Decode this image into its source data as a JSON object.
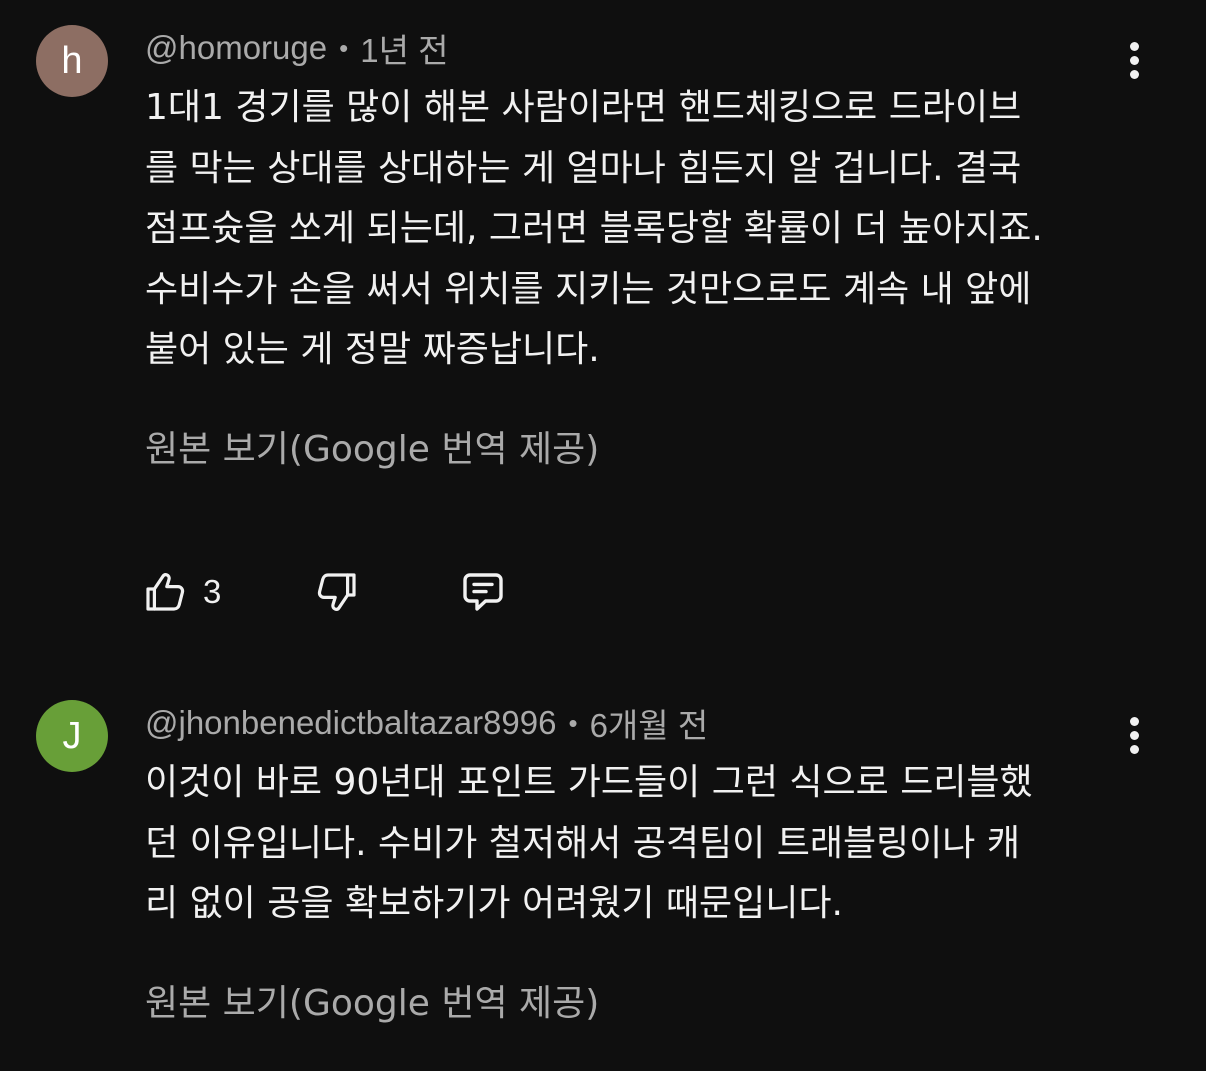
{
  "comments": [
    {
      "avatar_letter": "h",
      "avatar_color": "#8d6e63",
      "username": "@homoruge",
      "separator": "•",
      "time": "1년 전",
      "lines": [
        "1대1 경기를 많이 해본 사람이라면 핸드체킹으로 드라이브",
        "를 막는 상대를 상대하는 게 얼마나 힘든지 알 겁니다. 결국",
        "점프슛을 쏘게 되는데, 그러면 블록당할 확률이 더 높아지죠.",
        "수비수가 손을 써서 위치를 지키는 것만으로도 계속 내 앞에",
        "붙어 있는 게 정말 짜증납니다."
      ],
      "translate_link": "원본 보기(Google 번역 제공)",
      "like_count": "3",
      "icons": {
        "like": "thumbs-up-icon",
        "dislike": "thumbs-down-icon",
        "reply": "reply-icon",
        "more": "more-vert-icon"
      }
    },
    {
      "avatar_letter": "J",
      "avatar_color": "#689f38",
      "username": "@jhonbenedictbaltazar8996",
      "separator": "•",
      "time": "6개월 전",
      "lines": [
        "이것이 바로 90년대 포인트 가드들이 그런 식으로 드리블했",
        "던 이유입니다. 수비가 철저해서 공격팀이 트래블링이나 캐",
        "리 없이 공을 확보하기가 어려웠기 때문입니다."
      ],
      "translate_link": "원본 보기(Google 번역 제공)",
      "icons": {
        "more": "more-vert-icon"
      }
    }
  ]
}
